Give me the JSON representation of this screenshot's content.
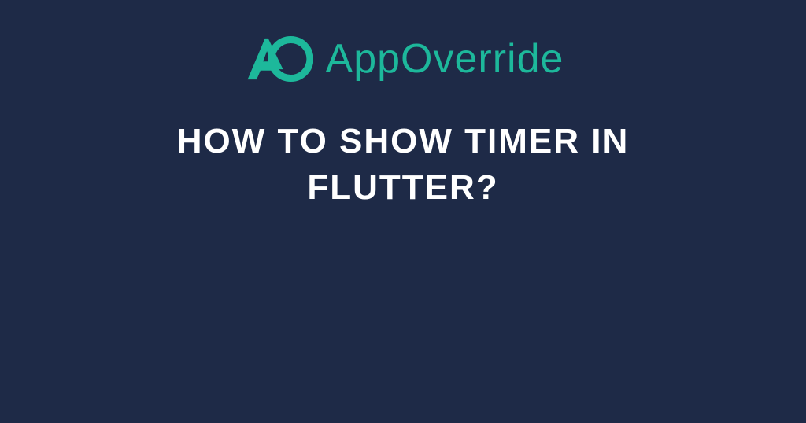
{
  "brand": {
    "name": "AppOverride",
    "accent_color": "#1db89b"
  },
  "headline": "How to Show Timer in Flutter?",
  "colors": {
    "background": "#1e2a47",
    "text": "#ffffff",
    "accent": "#1db89b"
  }
}
